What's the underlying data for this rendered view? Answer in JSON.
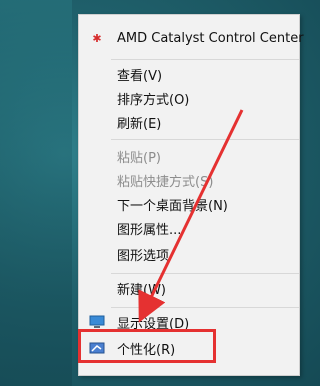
{
  "context_menu": {
    "items": [
      {
        "label": "AMD Catalyst Control Center",
        "icon": "amd-catalyst-icon",
        "disabled": false
      },
      {
        "label": "查看(V)",
        "disabled": false
      },
      {
        "label": "排序方式(O)",
        "disabled": false
      },
      {
        "label": "刷新(E)",
        "disabled": false
      },
      {
        "label": "粘贴(P)",
        "disabled": true
      },
      {
        "label": "粘贴快捷方式(S)",
        "disabled": true
      },
      {
        "label": "下一个桌面背景(N)",
        "disabled": false
      },
      {
        "label": "图形属性...",
        "disabled": false
      },
      {
        "label": "图形选项",
        "disabled": false
      },
      {
        "label": "新建(W)",
        "disabled": false
      },
      {
        "label": "显示设置(D)",
        "icon": "display-settings-icon",
        "disabled": false
      },
      {
        "label": "个性化(R)",
        "icon": "personalize-icon",
        "disabled": false
      }
    ]
  },
  "annotation": {
    "highlight_color": "#e53131"
  }
}
